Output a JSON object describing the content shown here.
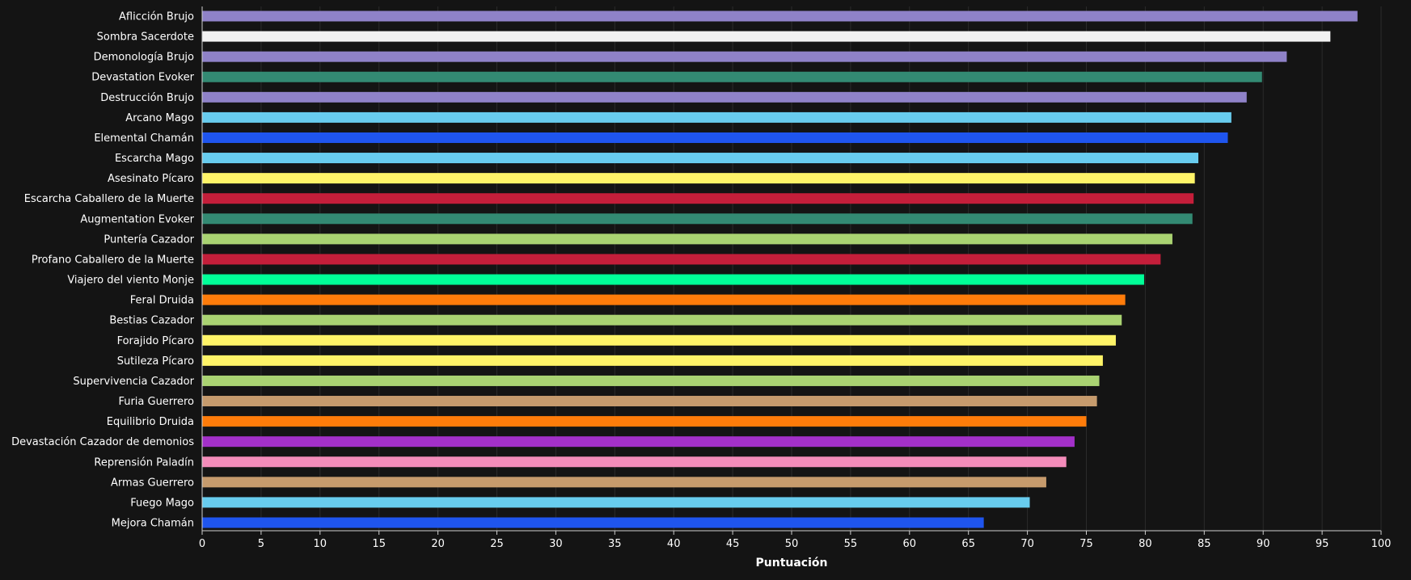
{
  "chart_data": {
    "type": "bar",
    "orientation": "horizontal",
    "title": "",
    "xlabel": "Puntuación",
    "ylabel": "",
    "xlim": [
      0,
      100
    ],
    "x_ticks": [
      0,
      5,
      10,
      15,
      20,
      25,
      30,
      35,
      40,
      45,
      50,
      55,
      60,
      65,
      70,
      75,
      80,
      85,
      90,
      95,
      100
    ],
    "grid": true,
    "background_color": "#141414",
    "bars": [
      {
        "label": "Aflicción Brujo",
        "value": 98.0,
        "color": "#8f82c8"
      },
      {
        "label": "Sombra Sacerdote",
        "value": 95.7,
        "color": "#f2f2f2"
      },
      {
        "label": "Demonología Brujo",
        "value": 92.0,
        "color": "#8f82c8"
      },
      {
        "label": "Devastation Evoker",
        "value": 89.9,
        "color": "#338a73"
      },
      {
        "label": "Destrucción Brujo",
        "value": 88.6,
        "color": "#8f82c8"
      },
      {
        "label": "Arcano Mago",
        "value": 87.3,
        "color": "#68ccee"
      },
      {
        "label": "Elemental Chamán",
        "value": 87.0,
        "color": "#1f55ee"
      },
      {
        "label": "Escarcha Mago",
        "value": 84.5,
        "color": "#68ccee"
      },
      {
        "label": "Asesinato Pícaro",
        "value": 84.2,
        "color": "#fff468"
      },
      {
        "label": "Escarcha Caballero de la Muerte",
        "value": 84.1,
        "color": "#c41e3a"
      },
      {
        "label": "Augmentation Evoker",
        "value": 84.0,
        "color": "#338a73"
      },
      {
        "label": "Puntería Cazador",
        "value": 82.3,
        "color": "#aad372"
      },
      {
        "label": "Profano Caballero de la Muerte",
        "value": 81.3,
        "color": "#c41e3a"
      },
      {
        "label": "Viajero del viento Monje",
        "value": 79.9,
        "color": "#00ff98"
      },
      {
        "label": "Feral Druida",
        "value": 78.3,
        "color": "#ff7c0a"
      },
      {
        "label": "Bestias Cazador",
        "value": 78.0,
        "color": "#aad372"
      },
      {
        "label": "Forajido Pícaro",
        "value": 77.5,
        "color": "#fff468"
      },
      {
        "label": "Sutileza Pícaro",
        "value": 76.4,
        "color": "#fff468"
      },
      {
        "label": "Supervivencia Cazador",
        "value": 76.1,
        "color": "#aad372"
      },
      {
        "label": "Furia Guerrero",
        "value": 75.9,
        "color": "#c69b6d"
      },
      {
        "label": "Equilibrio Druida",
        "value": 75.0,
        "color": "#ff7c0a"
      },
      {
        "label": "Devastación Cazador de demonios",
        "value": 74.0,
        "color": "#a330c9"
      },
      {
        "label": "Reprensión Paladín",
        "value": 73.3,
        "color": "#f48cba"
      },
      {
        "label": "Armas Guerrero",
        "value": 71.6,
        "color": "#c69b6d"
      },
      {
        "label": "Fuego Mago",
        "value": 70.2,
        "color": "#68ccee"
      },
      {
        "label": "Mejora Chamán",
        "value": 66.3,
        "color": "#1f55ee"
      }
    ]
  }
}
